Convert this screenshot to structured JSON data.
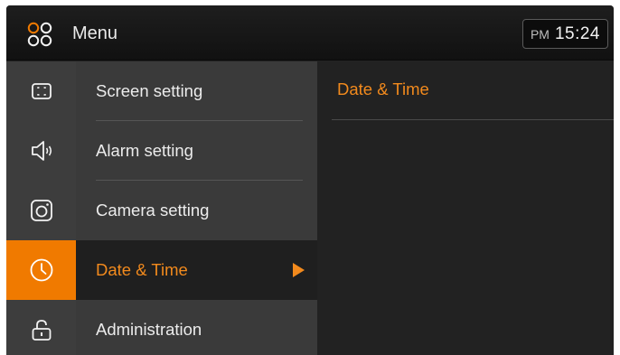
{
  "header": {
    "title": "Menu",
    "menu_icon": "grid-circles-icon",
    "clock": {
      "ampm": "PM",
      "time": "15:24"
    }
  },
  "colors": {
    "accent": "#f07a00",
    "accent_text": "#f28a1d"
  },
  "sidebar": {
    "items": [
      {
        "label": "Screen setting",
        "icon": "screen-icon",
        "active": false
      },
      {
        "label": "Alarm setting",
        "icon": "speaker-icon",
        "active": false
      },
      {
        "label": "Camera setting",
        "icon": "camera-icon",
        "active": false
      },
      {
        "label": "Date & Time",
        "icon": "clock-icon",
        "active": true
      },
      {
        "label": "Administration",
        "icon": "lock-icon",
        "active": false
      }
    ]
  },
  "content": {
    "title": "Date & Time"
  }
}
